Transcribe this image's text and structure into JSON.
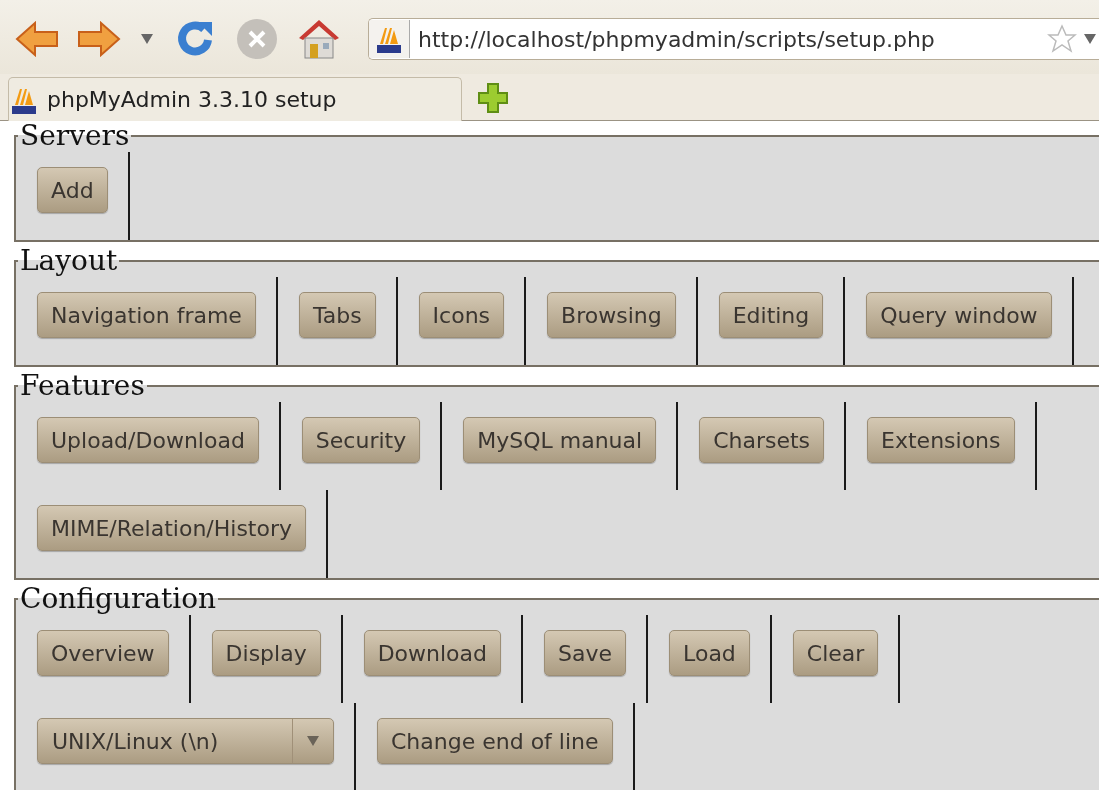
{
  "browser": {
    "url": "http://localhost/phpmyadmin/scripts/setup.php",
    "tabs": [
      {
        "title": "phpMyAdmin 3.3.10 setup",
        "selected": true
      }
    ]
  },
  "sections": [
    {
      "legend": "Servers",
      "items": [
        {
          "kind": "button",
          "label": "Add"
        }
      ]
    },
    {
      "legend": "Layout",
      "items": [
        {
          "kind": "button",
          "label": "Navigation frame"
        },
        {
          "kind": "button",
          "label": "Tabs"
        },
        {
          "kind": "button",
          "label": "Icons"
        },
        {
          "kind": "button",
          "label": "Browsing"
        },
        {
          "kind": "button",
          "label": "Editing"
        },
        {
          "kind": "button",
          "label": "Query window"
        }
      ]
    },
    {
      "legend": "Features",
      "items": [
        {
          "kind": "button",
          "label": "Upload/Download"
        },
        {
          "kind": "button",
          "label": "Security"
        },
        {
          "kind": "button",
          "label": "MySQL manual"
        },
        {
          "kind": "button",
          "label": "Charsets"
        },
        {
          "kind": "button",
          "label": "Extensions"
        },
        {
          "kind": "button",
          "label": "MIME/Relation/History"
        }
      ]
    },
    {
      "legend": "Configuration",
      "items": [
        {
          "kind": "button",
          "label": "Overview"
        },
        {
          "kind": "button",
          "label": "Display"
        },
        {
          "kind": "button",
          "label": "Download"
        },
        {
          "kind": "button",
          "label": "Save"
        },
        {
          "kind": "button",
          "label": "Load"
        },
        {
          "kind": "button",
          "label": "Clear"
        },
        {
          "kind": "select",
          "value": "UNIX/Linux (\\n)"
        },
        {
          "kind": "button",
          "label": "Change end of line"
        }
      ]
    }
  ]
}
